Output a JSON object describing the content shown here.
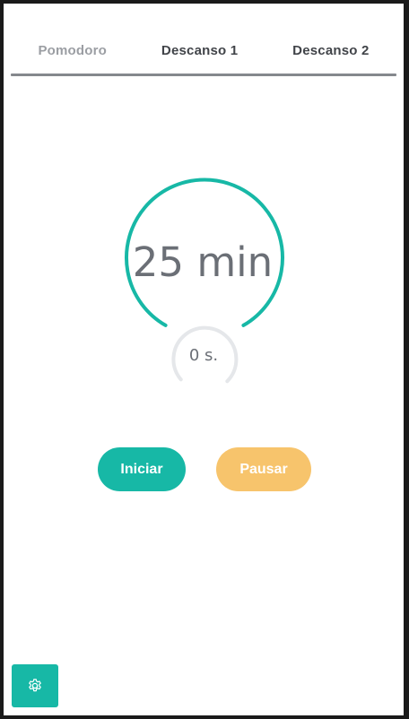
{
  "tabs": [
    {
      "label": "Pomodoro",
      "active": false
    },
    {
      "label": "Descanso 1",
      "active": true
    },
    {
      "label": "Descanso 2",
      "active": true
    }
  ],
  "timer": {
    "minutes_text": "25 min",
    "seconds_text": "0 s."
  },
  "buttons": {
    "start_label": "Iniciar",
    "pause_label": "Pausar"
  },
  "settings": {
    "icon": "gear-icon"
  },
  "colors": {
    "accent": "#17b8a6",
    "pause": "#f7c46c",
    "ring_track": "#e5e7ea",
    "text": "#6b6f76"
  }
}
